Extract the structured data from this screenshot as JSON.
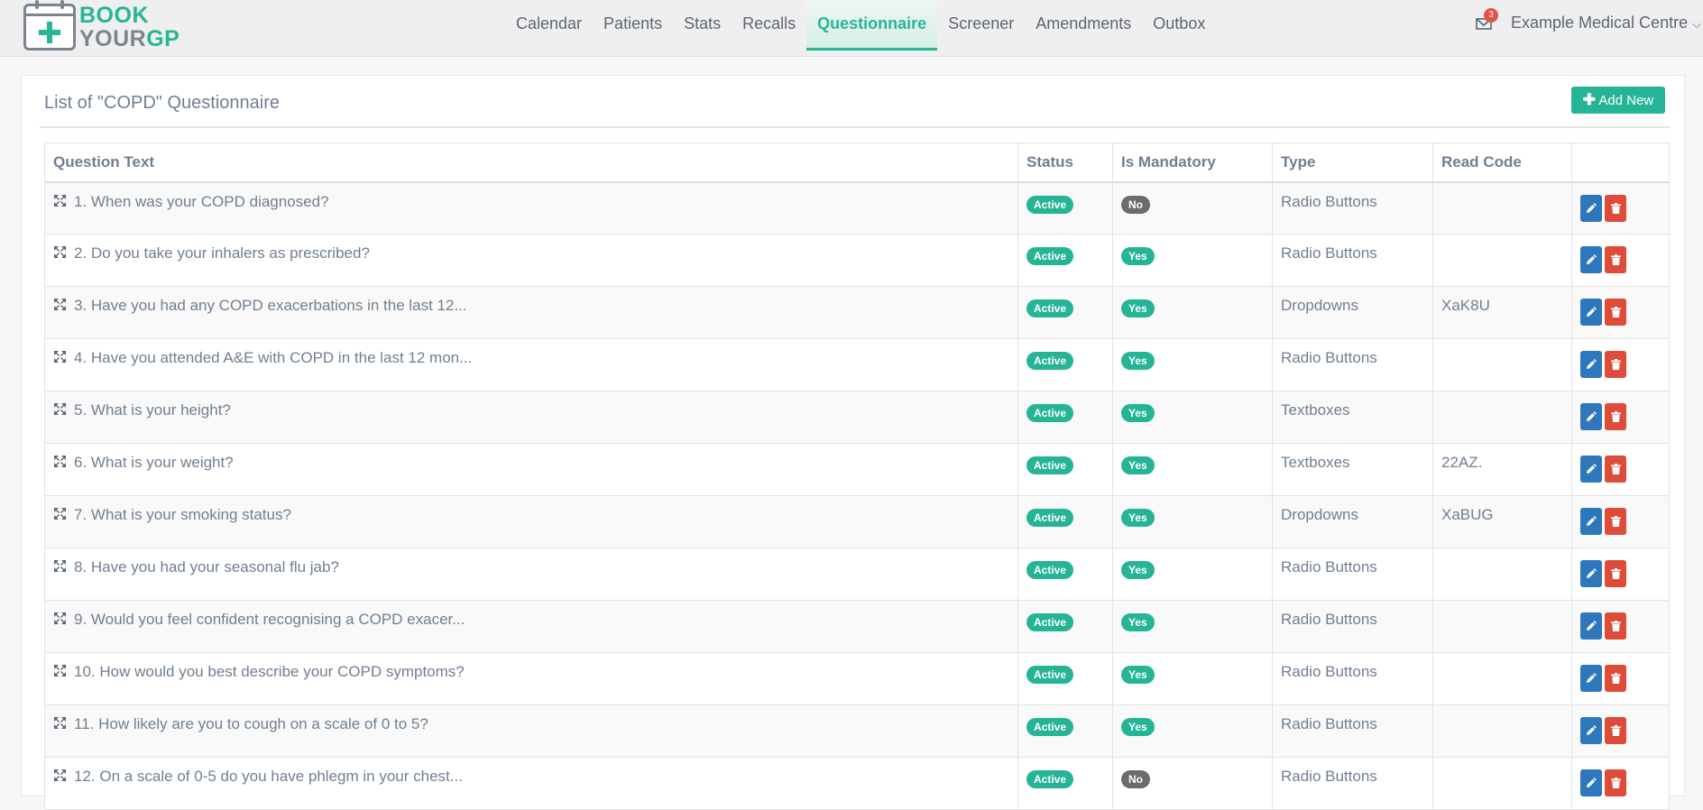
{
  "brand": {
    "line1": "BOOK",
    "line2_a": "YOUR",
    "line2_b": "GP"
  },
  "nav": {
    "items": [
      "Calendar",
      "Patients",
      "Stats",
      "Recalls",
      "Questionnaire",
      "Screener",
      "Amendments",
      "Outbox"
    ],
    "active": "Questionnaire"
  },
  "header": {
    "mail_count": "3",
    "account_name": "Example Medical Centre",
    "account_caret": "⌵"
  },
  "panel": {
    "title": "List of \"COPD\" Questionnaire",
    "add_plus": "✚",
    "add_label": "Add New"
  },
  "table": {
    "columns": [
      "Question Text",
      "Status",
      "Is Mandatory",
      "Type",
      "Read Code",
      ""
    ],
    "rows": [
      {
        "question": "1. When was your COPD diagnosed?",
        "status": "Active",
        "mandatory": "No",
        "type": "Radio Buttons",
        "read_code": ""
      },
      {
        "question": "2. Do you take your inhalers as prescribed?",
        "status": "Active",
        "mandatory": "Yes",
        "type": "Radio Buttons",
        "read_code": ""
      },
      {
        "question": "3. Have you had any COPD exacerbations in the last 12...",
        "status": "Active",
        "mandatory": "Yes",
        "type": "Dropdowns",
        "read_code": "XaK8U"
      },
      {
        "question": "4. Have you attended A&E with COPD in the last 12 mon...",
        "status": "Active",
        "mandatory": "Yes",
        "type": "Radio Buttons",
        "read_code": ""
      },
      {
        "question": "5. What is your height?",
        "status": "Active",
        "mandatory": "Yes",
        "type": "Textboxes",
        "read_code": ""
      },
      {
        "question": "6. What is your weight?",
        "status": "Active",
        "mandatory": "Yes",
        "type": "Textboxes",
        "read_code": "22AZ."
      },
      {
        "question": "7. What is your smoking status?",
        "status": "Active",
        "mandatory": "Yes",
        "type": "Dropdowns",
        "read_code": "XaBUG"
      },
      {
        "question": "8. Have you had your seasonal flu jab?",
        "status": "Active",
        "mandatory": "Yes",
        "type": "Radio Buttons",
        "read_code": ""
      },
      {
        "question": "9. Would you feel confident recognising a COPD exacer...",
        "status": "Active",
        "mandatory": "Yes",
        "type": "Radio Buttons",
        "read_code": ""
      },
      {
        "question": "10. How would you best describe your COPD symptoms?",
        "status": "Active",
        "mandatory": "Yes",
        "type": "Radio Buttons",
        "read_code": ""
      },
      {
        "question": "11. How likely are you to cough on a scale of 0 to 5?",
        "status": "Active",
        "mandatory": "Yes",
        "type": "Radio Buttons",
        "read_code": ""
      },
      {
        "question": "12. On a scale of 0-5 do you have phlegm in your chest...",
        "status": "Active",
        "mandatory": "No",
        "type": "Radio Buttons",
        "read_code": ""
      }
    ]
  },
  "icons": {
    "drag": "drag-move-icon",
    "mail": "envelope-icon",
    "edit": "pencil-icon",
    "delete": "trash-icon"
  },
  "colors": {
    "accent": "#26b497",
    "edit": "#2f77bc",
    "delete": "#dd4b39",
    "badge_no": "#6c6c6c",
    "mail_badge": "#e0544a"
  }
}
